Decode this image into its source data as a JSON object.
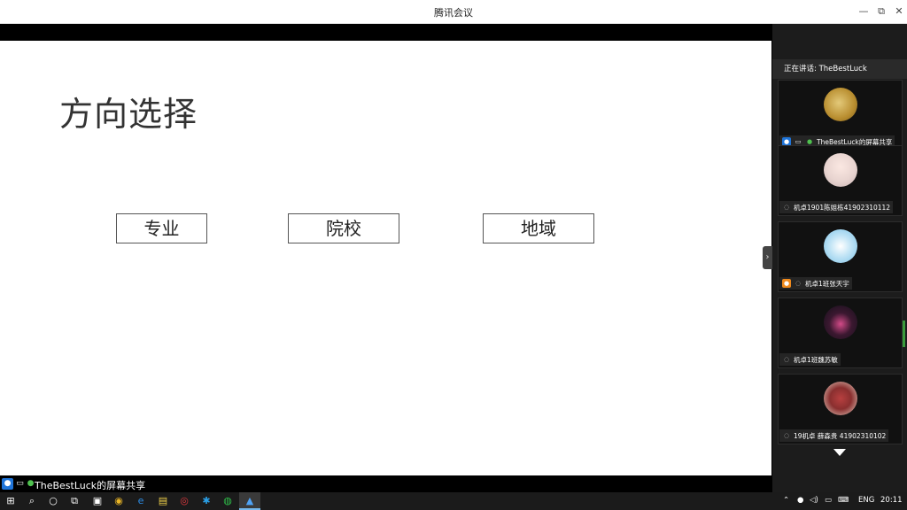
{
  "window": {
    "title": "腾讯会议",
    "minimize": "—",
    "maximize": "⧉",
    "close": "✕"
  },
  "slide": {
    "title": "方向选择",
    "options": [
      "专业",
      "院校",
      "地域"
    ]
  },
  "collapse_handle": "›",
  "share_bar": {
    "label": "TheBestLuck的屏幕共享"
  },
  "panel": {
    "speaking": "正在讲话: TheBestLuck",
    "participants": [
      {
        "name": "TheBestLuck的屏幕共享"
      },
      {
        "name": "机卓1901陈姐栋41902310112"
      },
      {
        "name": "机卓1班张天宇"
      },
      {
        "name": "机卓1班魏苏敏"
      },
      {
        "name": "19机卓 薛森贵 41902310102"
      }
    ]
  },
  "taskbar": {
    "language": "ENG",
    "time": "20:11"
  },
  "icons": {
    "user": "user-icon",
    "screen": "screen-share-icon",
    "mic": "mic-icon",
    "mic_muted": "mic-muted-icon"
  },
  "colors": {
    "accent_blue": "#1f74d8",
    "mic_green": "#4fc14f",
    "host_orange": "#f08a1c"
  }
}
